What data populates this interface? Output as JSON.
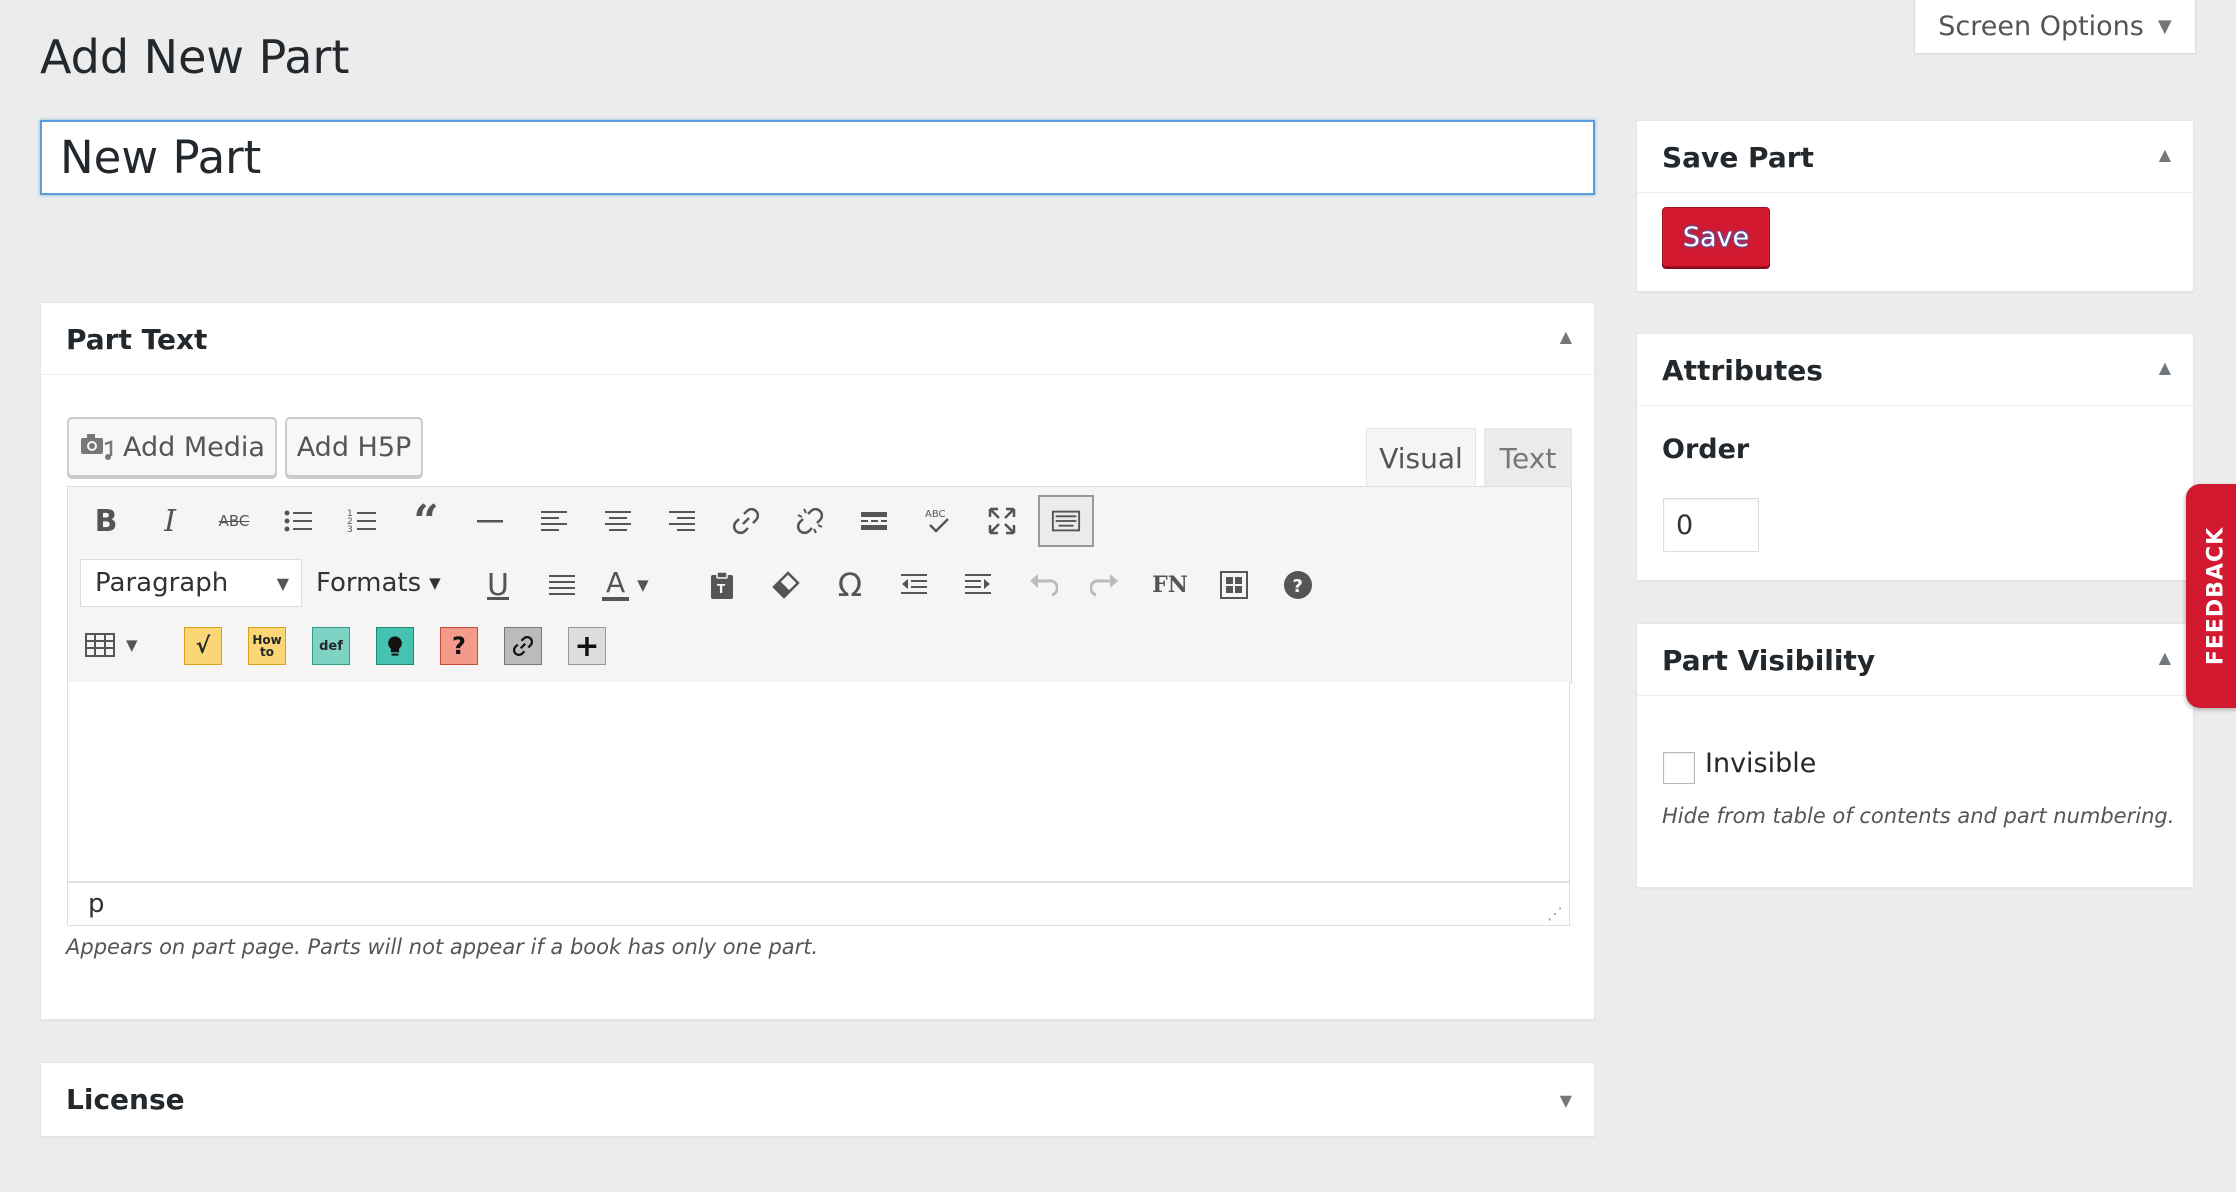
{
  "header": {
    "page_title": "Add New Part",
    "screen_options_label": "Screen Options"
  },
  "title_field": {
    "value": "New Part"
  },
  "part_text": {
    "title": "Part Text",
    "add_media_label": "Add Media",
    "add_h5p_label": "Add H5P",
    "tab_visual": "Visual",
    "tab_text": "Text",
    "paragraph_select": "Paragraph",
    "formats_label": "Formats",
    "fn_label": "FN",
    "path_label": "p",
    "hint": "Appears on part page. Parts will not appear if a book has only one part."
  },
  "license": {
    "title": "License"
  },
  "save_part": {
    "title": "Save Part",
    "save_label": "Save"
  },
  "attributes": {
    "title": "Attributes",
    "order_label": "Order",
    "order_value": "0"
  },
  "visibility": {
    "title": "Part Visibility",
    "invisible_label": "Invisible",
    "invisible_checked": false,
    "hint": "Hide from table of contents and part numbering."
  },
  "feedback": {
    "label": "FEEDBACK"
  },
  "colors": {
    "accent_red": "#d2192f",
    "focus_blue": "#5b9dd9",
    "background": "#ececec"
  }
}
